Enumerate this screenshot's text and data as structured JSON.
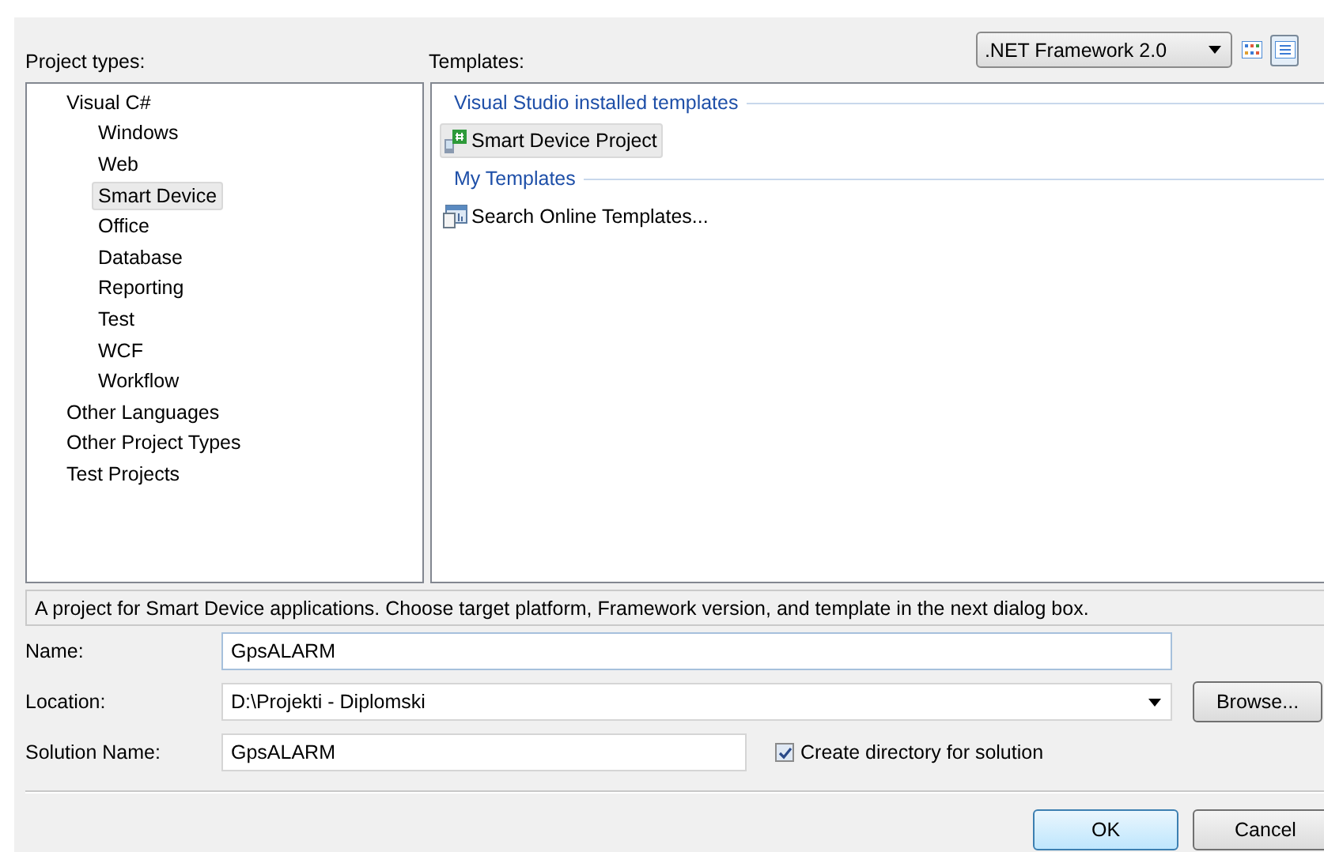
{
  "framework": {
    "value": ".NET Framework 2.0"
  },
  "view_buttons": [
    {
      "kind": "large",
      "selected": false
    },
    {
      "kind": "small",
      "selected": true
    }
  ],
  "project_types": {
    "label": "Project types:",
    "items": [
      {
        "label": "Visual C#",
        "selected": false,
        "children": [
          {
            "label": "Windows",
            "selected": false
          },
          {
            "label": "Web",
            "selected": false
          },
          {
            "label": "Smart Device",
            "selected": true
          },
          {
            "label": "Office",
            "selected": false
          },
          {
            "label": "Database",
            "selected": false
          },
          {
            "label": "Reporting",
            "selected": false
          },
          {
            "label": "Test",
            "selected": false
          },
          {
            "label": "WCF",
            "selected": false
          },
          {
            "label": "Workflow",
            "selected": false
          }
        ]
      },
      {
        "label": "Other Languages",
        "selected": false
      },
      {
        "label": "Other Project Types",
        "selected": false
      },
      {
        "label": "Test Projects",
        "selected": false
      }
    ]
  },
  "templates": {
    "label": "Templates:",
    "groups": [
      {
        "title": "Visual Studio installed templates",
        "items": [
          {
            "label": "Smart Device Project",
            "kind": "project",
            "selected": true
          }
        ]
      },
      {
        "title": "My Templates",
        "items": [
          {
            "label": "Search Online Templates...",
            "kind": "search",
            "selected": false
          }
        ]
      }
    ]
  },
  "description": "A project for Smart Device applications. Choose target platform, Framework version, and template in the next dialog box.",
  "fields": [
    {
      "label": "Name:",
      "value": "GpsALARM",
      "kind": "text"
    },
    {
      "label": "Location:",
      "value": "D:\\Projekti - Diplomski",
      "kind": "combo"
    },
    {
      "label": "Solution Name:",
      "value": "GpsALARM",
      "kind": "short"
    }
  ],
  "browse_button": "Browse...",
  "create_directory": {
    "label": "Create directory for solution",
    "checked": true
  },
  "buttons": [
    "OK",
    "Cancel"
  ]
}
